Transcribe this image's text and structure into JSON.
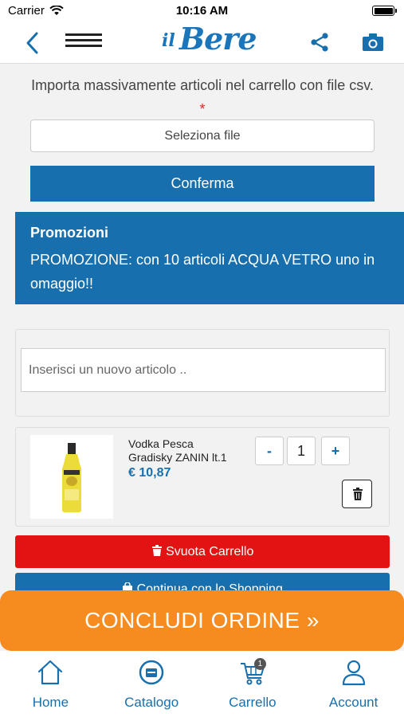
{
  "status_bar": {
    "carrier": "Carrier",
    "time": "10:16 AM"
  },
  "header": {
    "logo_il": "il",
    "logo_bere": "Bere",
    "icons": [
      "back-icon",
      "hamburger-menu-icon",
      "share-icon",
      "camera-icon"
    ]
  },
  "csv_import": {
    "label": "Importa massivamente articoli nel carrello con file csv.",
    "required_mark": "*",
    "file_button": "Seleziona file",
    "confirm_button": "Conferma"
  },
  "promotions": {
    "title": "Promozioni",
    "text": "PROMOZIONE: con 10 articoli ACQUA VETRO uno in omaggio!!"
  },
  "new_item": {
    "placeholder": "Inserisci un nuovo articolo .."
  },
  "cart_items": [
    {
      "name": "Vodka Pesca Gradisky ZANIN lt.1",
      "price": "€ 10,87",
      "quantity": "1",
      "minus": "-",
      "plus": "+"
    }
  ],
  "actions": {
    "empty_cart": "Svuota Carrello",
    "continue_shopping": "Continua con lo Shopping",
    "checkout": "CONCLUDI ORDINE »"
  },
  "tab_bar": {
    "items": [
      {
        "label": "Home",
        "icon": "home-icon"
      },
      {
        "label": "Catalogo",
        "icon": "catalog-icon"
      },
      {
        "label": "Carrello",
        "icon": "cart-icon",
        "badge": "1"
      },
      {
        "label": "Account",
        "icon": "account-icon"
      }
    ]
  },
  "colors": {
    "primary": "#1770ad",
    "danger": "#e31313",
    "checkout": "#f68b1f",
    "background": "#f2f2f2"
  }
}
